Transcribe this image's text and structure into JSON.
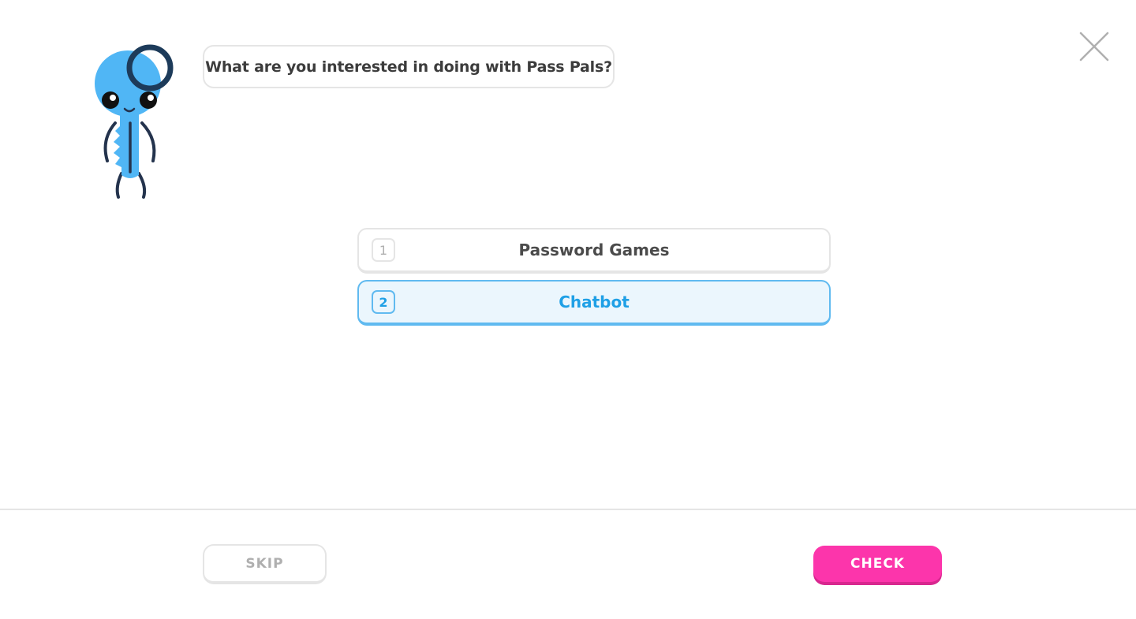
{
  "header": {
    "close_icon": "close-icon"
  },
  "mascot": {
    "icon": "key-mascot",
    "colors": {
      "body": "#50b6f5",
      "ring": "#1d3b5a",
      "limbs": "#24334d"
    }
  },
  "prompt": {
    "question": "What are you interested in doing with Pass Pals?"
  },
  "options": [
    {
      "key": "1",
      "label": "Password Games",
      "selected": false
    },
    {
      "key": "2",
      "label": "Chatbot",
      "selected": true
    }
  ],
  "footer": {
    "skip_label": "SKIP",
    "check_label": "CHECK"
  },
  "colors": {
    "accent_pink": "#fc35ab",
    "selected_blue": "#1fa0e6",
    "selected_bg": "#ebf6fd",
    "border_gray": "#e5e5e5"
  }
}
